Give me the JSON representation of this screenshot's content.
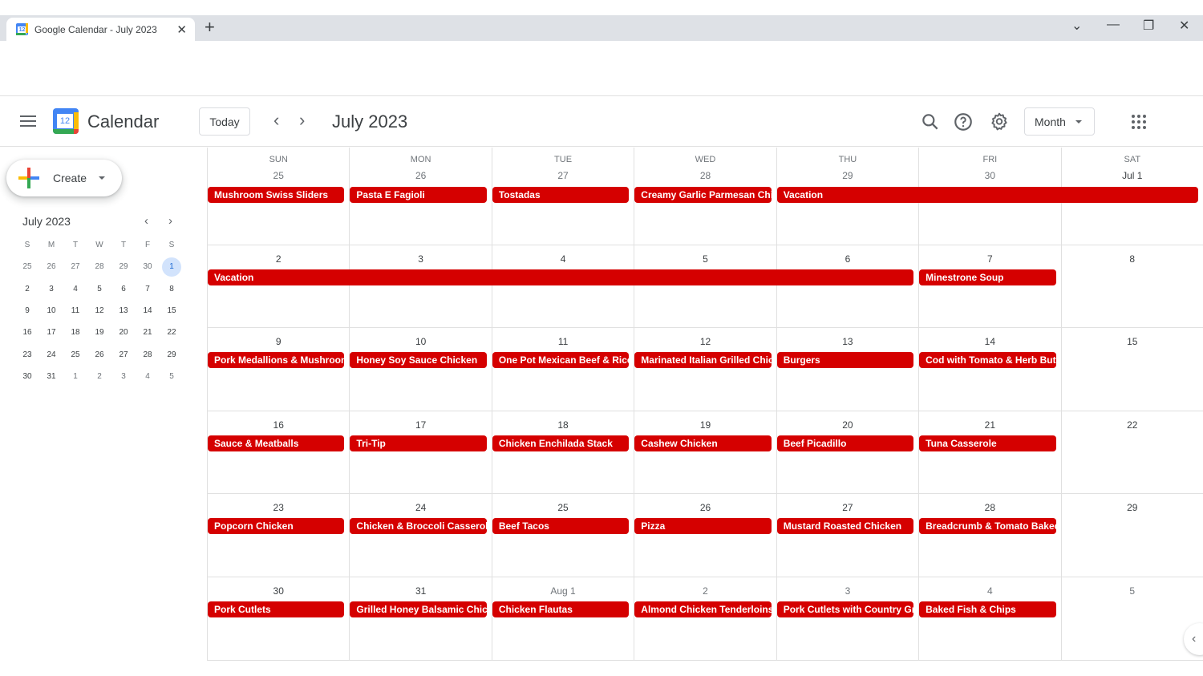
{
  "browser": {
    "tab_title": "Google Calendar - July 2023",
    "favicon_text": "12",
    "tab_close": "✕",
    "new_tab": "+",
    "controls": {
      "dropdown": "⌄",
      "minimize": "—",
      "restore": "❐",
      "close": "✕"
    }
  },
  "header": {
    "app_name": "Calendar",
    "logo_text": "12",
    "today_label": "Today",
    "prev_label": "‹",
    "next_label": "›",
    "title": "July 2023",
    "view_label": "Month",
    "icons": [
      "search-icon",
      "help-icon",
      "settings-icon",
      "apps-icon"
    ]
  },
  "sidebar": {
    "create_label": "Create",
    "mini_calendar": {
      "title": "July 2023",
      "prev": "‹",
      "next": "›",
      "weekday_heads": [
        "S",
        "M",
        "T",
        "W",
        "T",
        "F",
        "S"
      ],
      "weeks": [
        [
          "25",
          "26",
          "27",
          "28",
          "29",
          "30",
          "1"
        ],
        [
          "2",
          "3",
          "4",
          "5",
          "6",
          "7",
          "8"
        ],
        [
          "9",
          "10",
          "11",
          "12",
          "13",
          "14",
          "15"
        ],
        [
          "16",
          "17",
          "18",
          "19",
          "20",
          "21",
          "22"
        ],
        [
          "23",
          "24",
          "25",
          "26",
          "27",
          "28",
          "29"
        ],
        [
          "30",
          "31",
          "1",
          "2",
          "3",
          "4",
          "5"
        ]
      ],
      "dim_cells": [
        [
          0,
          0
        ],
        [
          0,
          1
        ],
        [
          0,
          2
        ],
        [
          0,
          3
        ],
        [
          0,
          4
        ],
        [
          0,
          5
        ],
        [
          5,
          2
        ],
        [
          5,
          3
        ],
        [
          5,
          4
        ],
        [
          5,
          5
        ],
        [
          5,
          6
        ]
      ],
      "selected_cell": [
        0,
        6
      ]
    }
  },
  "month": {
    "weekdays": [
      "SUN",
      "MON",
      "TUE",
      "WED",
      "THU",
      "FRI",
      "SAT"
    ],
    "event_color": "#d50000",
    "weeks": [
      {
        "days": [
          "25",
          "26",
          "27",
          "28",
          "29",
          "30",
          "Jul 1"
        ],
        "dim": [
          true,
          true,
          true,
          true,
          true,
          true,
          false
        ],
        "events": [
          {
            "title": "Mushroom Swiss Sliders",
            "start": 0,
            "span": 1
          },
          {
            "title": "Pasta E Fagioli",
            "start": 1,
            "span": 1
          },
          {
            "title": "Tostadas",
            "start": 2,
            "span": 1
          },
          {
            "title": "Creamy Garlic Parmesan Chicken",
            "start": 3,
            "span": 1
          },
          {
            "title": "Vacation",
            "start": 4,
            "span": 3
          }
        ]
      },
      {
        "days": [
          "2",
          "3",
          "4",
          "5",
          "6",
          "7",
          "8"
        ],
        "dim": [
          false,
          false,
          false,
          false,
          false,
          false,
          false
        ],
        "events": [
          {
            "title": "Vacation",
            "start": 0,
            "span": 5
          },
          {
            "title": "Minestrone Soup",
            "start": 5,
            "span": 1
          }
        ]
      },
      {
        "days": [
          "9",
          "10",
          "11",
          "12",
          "13",
          "14",
          "15"
        ],
        "dim": [
          false,
          false,
          false,
          false,
          false,
          false,
          false
        ],
        "events": [
          {
            "title": "Pork Medallions & Mushroom",
            "start": 0,
            "span": 1
          },
          {
            "title": "Honey Soy Sauce Chicken",
            "start": 1,
            "span": 1
          },
          {
            "title": "One Pot Mexican Beef & Rice",
            "start": 2,
            "span": 1
          },
          {
            "title": "Marinated Italian Grilled Chicken",
            "start": 3,
            "span": 1
          },
          {
            "title": "Burgers",
            "start": 4,
            "span": 1
          },
          {
            "title": "Cod with Tomato & Herb Butter",
            "start": 5,
            "span": 1
          }
        ]
      },
      {
        "days": [
          "16",
          "17",
          "18",
          "19",
          "20",
          "21",
          "22"
        ],
        "dim": [
          false,
          false,
          false,
          false,
          false,
          false,
          false
        ],
        "events": [
          {
            "title": "Sauce & Meatballs",
            "start": 0,
            "span": 1
          },
          {
            "title": "Tri-Tip",
            "start": 1,
            "span": 1
          },
          {
            "title": "Chicken Enchilada Stack",
            "start": 2,
            "span": 1
          },
          {
            "title": "Cashew Chicken",
            "start": 3,
            "span": 1
          },
          {
            "title": "Beef Picadillo",
            "start": 4,
            "span": 1
          },
          {
            "title": "Tuna Casserole",
            "start": 5,
            "span": 1
          }
        ]
      },
      {
        "days": [
          "23",
          "24",
          "25",
          "26",
          "27",
          "28",
          "29"
        ],
        "dim": [
          false,
          false,
          false,
          false,
          false,
          false,
          false
        ],
        "events": [
          {
            "title": "Popcorn Chicken",
            "start": 0,
            "span": 1
          },
          {
            "title": "Chicken & Broccoli Casserole",
            "start": 1,
            "span": 1
          },
          {
            "title": "Beef Tacos",
            "start": 2,
            "span": 1
          },
          {
            "title": "Pizza",
            "start": 3,
            "span": 1
          },
          {
            "title": "Mustard Roasted Chicken",
            "start": 4,
            "span": 1
          },
          {
            "title": "Breadcrumb & Tomato Baked",
            "start": 5,
            "span": 1
          }
        ]
      },
      {
        "days": [
          "30",
          "31",
          "Aug 1",
          "2",
          "3",
          "4",
          "5"
        ],
        "dim": [
          false,
          false,
          true,
          true,
          true,
          true,
          true
        ],
        "events": [
          {
            "title": "Pork Cutlets",
            "start": 0,
            "span": 1
          },
          {
            "title": "Grilled Honey Balsamic Chicken",
            "start": 1,
            "span": 1
          },
          {
            "title": "Chicken Flautas",
            "start": 2,
            "span": 1
          },
          {
            "title": "Almond Chicken Tenderloins",
            "start": 3,
            "span": 1
          },
          {
            "title": "Pork Cutlets with Country Gravy",
            "start": 4,
            "span": 1
          },
          {
            "title": "Baked Fish & Chips",
            "start": 5,
            "span": 1
          }
        ]
      }
    ]
  },
  "side_panel_toggle": "‹"
}
